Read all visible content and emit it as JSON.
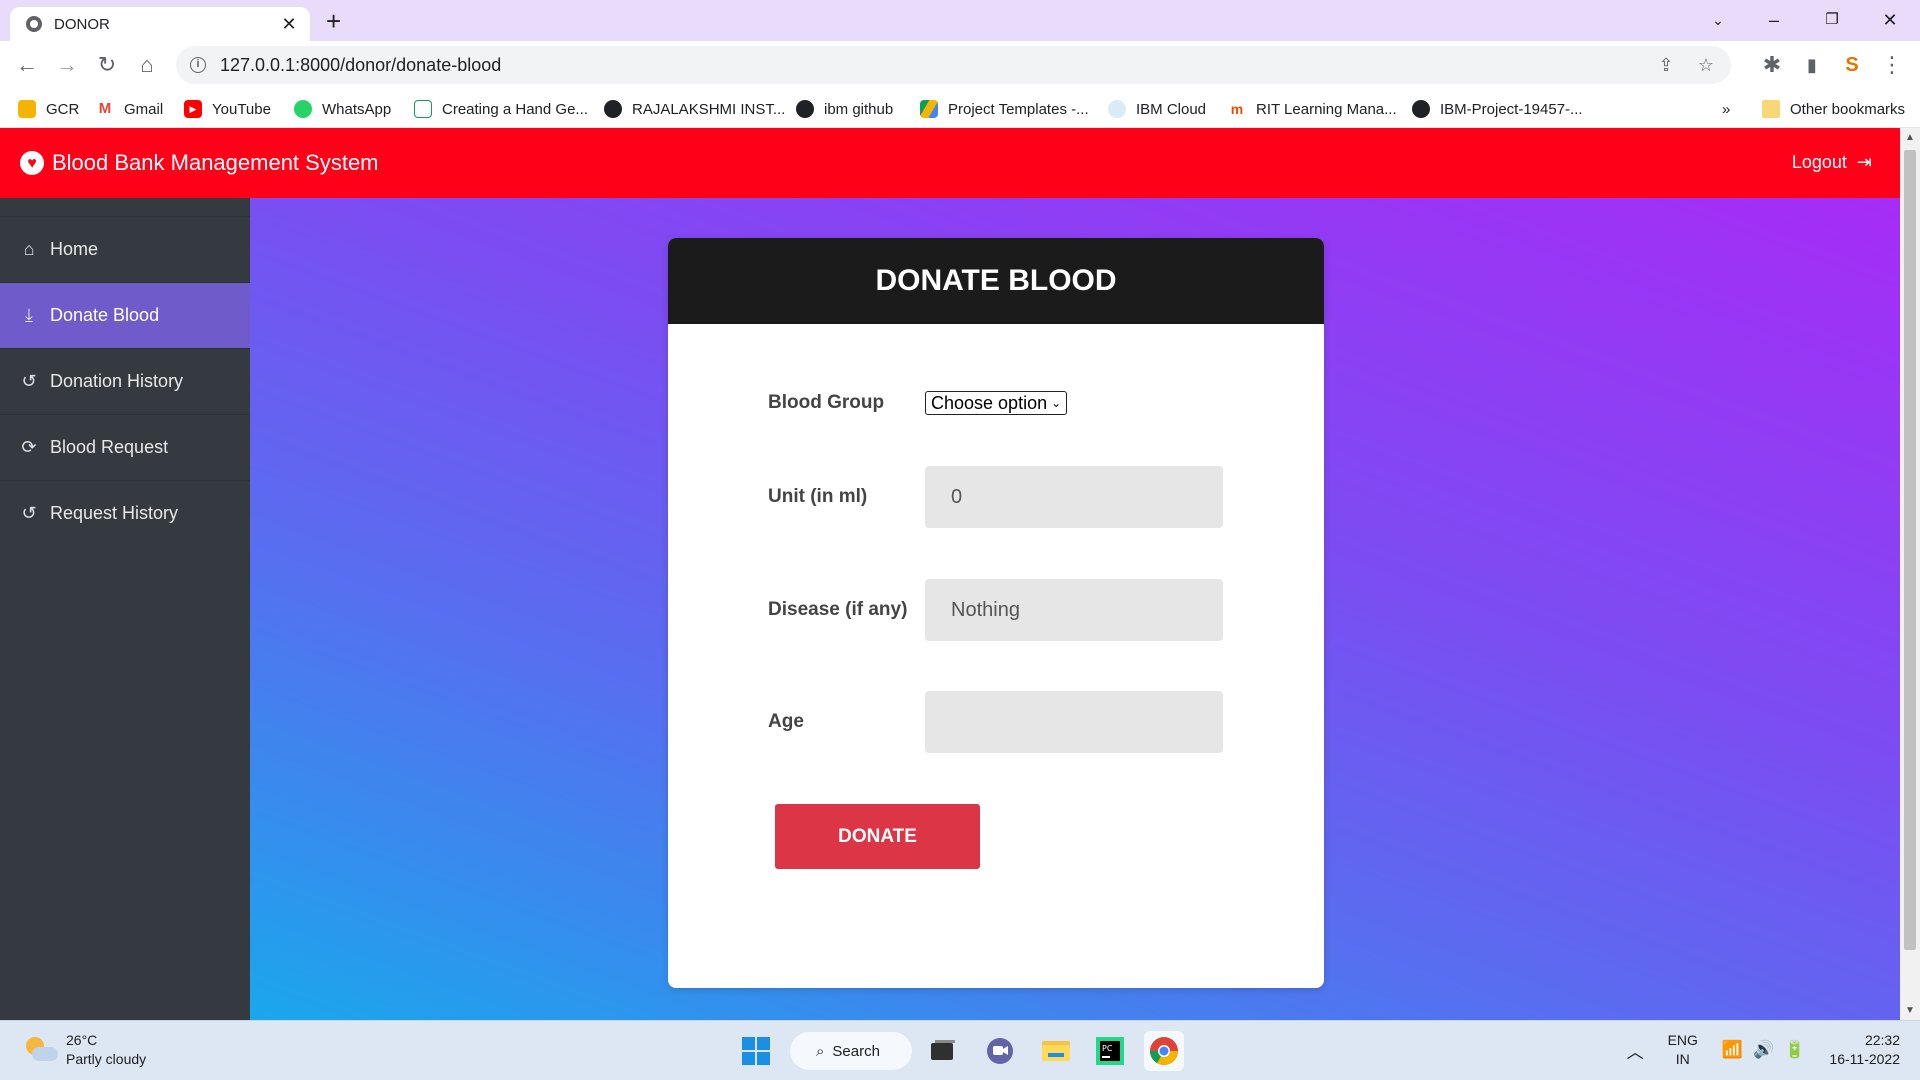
{
  "browser": {
    "tab_title": "DONOR",
    "url": "127.0.0.1:8000/donor/donate-blood",
    "bookmarks": [
      "GCR",
      "Gmail",
      "YouTube",
      "WhatsApp",
      "Creating a Hand Ge...",
      "RAJALAKSHMI INST...",
      "ibm github",
      "Project Templates -...",
      "IBM Cloud",
      "RIT Learning Mana...",
      "IBM-Project-19457-..."
    ],
    "bookmarks_overflow": "»",
    "other_bookmarks": "Other bookmarks"
  },
  "app": {
    "brand": "Blood Bank Management System",
    "logout": "Logout",
    "accent_color": "#ff0019"
  },
  "sidebar": {
    "items": [
      {
        "label": "Home",
        "icon": "home-icon"
      },
      {
        "label": "Donate Blood",
        "icon": "donate-icon",
        "active": true
      },
      {
        "label": "Donation History",
        "icon": "history-icon"
      },
      {
        "label": "Blood Request",
        "icon": "refresh-icon"
      },
      {
        "label": "Request History",
        "icon": "history-icon"
      }
    ]
  },
  "form": {
    "title": "DONATE BLOOD",
    "blood_group_label": "Blood Group",
    "blood_group_value": "Choose option",
    "unit_label": "Unit (in ml)",
    "unit_value": "0",
    "disease_label": "Disease (if any)",
    "disease_value": "Nothing",
    "age_label": "Age",
    "age_value": "",
    "submit_label": "DONATE"
  },
  "taskbar": {
    "temperature": "26°C",
    "weather": "Partly cloudy",
    "search_label": "Search",
    "lang_line1": "ENG",
    "lang_line2": "IN",
    "time": "22:32",
    "date": "16-11-2022"
  }
}
